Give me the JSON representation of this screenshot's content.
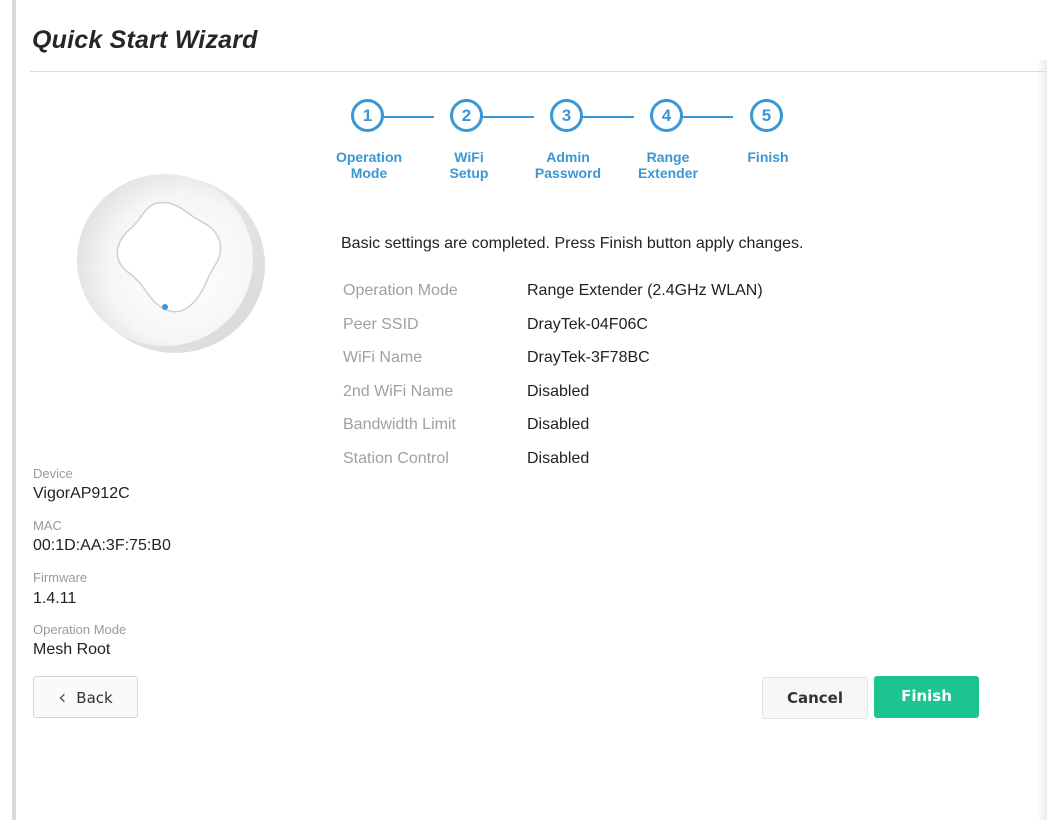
{
  "page": {
    "title": "Quick Start Wizard"
  },
  "stepper": {
    "color": "#3a97d6",
    "steps": [
      {
        "number": "1",
        "line1": "Operation",
        "line2": "Mode"
      },
      {
        "number": "2",
        "line1": "WiFi",
        "line2": "Setup"
      },
      {
        "number": "3",
        "line1": "Admin",
        "line2": "Password"
      },
      {
        "number": "4",
        "line1": "Range",
        "line2": "Extender"
      },
      {
        "number": "5",
        "line1": "Finish",
        "line2": ""
      }
    ]
  },
  "device_info": {
    "device_label": "Device",
    "device_value": "VigorAP912C",
    "mac_label": "MAC",
    "mac_value": "00:1D:AA:3F:75:B0",
    "firmware_label": "Firmware",
    "firmware_value": "1.4.11",
    "opmode_label": "Operation Mode",
    "opmode_value": "Mesh Root"
  },
  "summary": {
    "message": "Basic settings are completed. Press Finish button apply changes.",
    "rows": [
      {
        "label": "Operation Mode",
        "value": "Range Extender (2.4GHz WLAN)"
      },
      {
        "label": "Peer SSID",
        "value": "DrayTek-04F06C"
      },
      {
        "label": "WiFi Name",
        "value": "DrayTek-3F78BC"
      },
      {
        "label": "2nd WiFi Name",
        "value": "Disabled"
      },
      {
        "label": "Bandwidth Limit",
        "value": "Disabled"
      },
      {
        "label": "Station Control",
        "value": "Disabled"
      }
    ]
  },
  "buttons": {
    "back": "Back",
    "cancel": "Cancel",
    "finish": "Finish",
    "back_icon": "chevron-left-icon",
    "finish_color": "#1cc58f"
  }
}
